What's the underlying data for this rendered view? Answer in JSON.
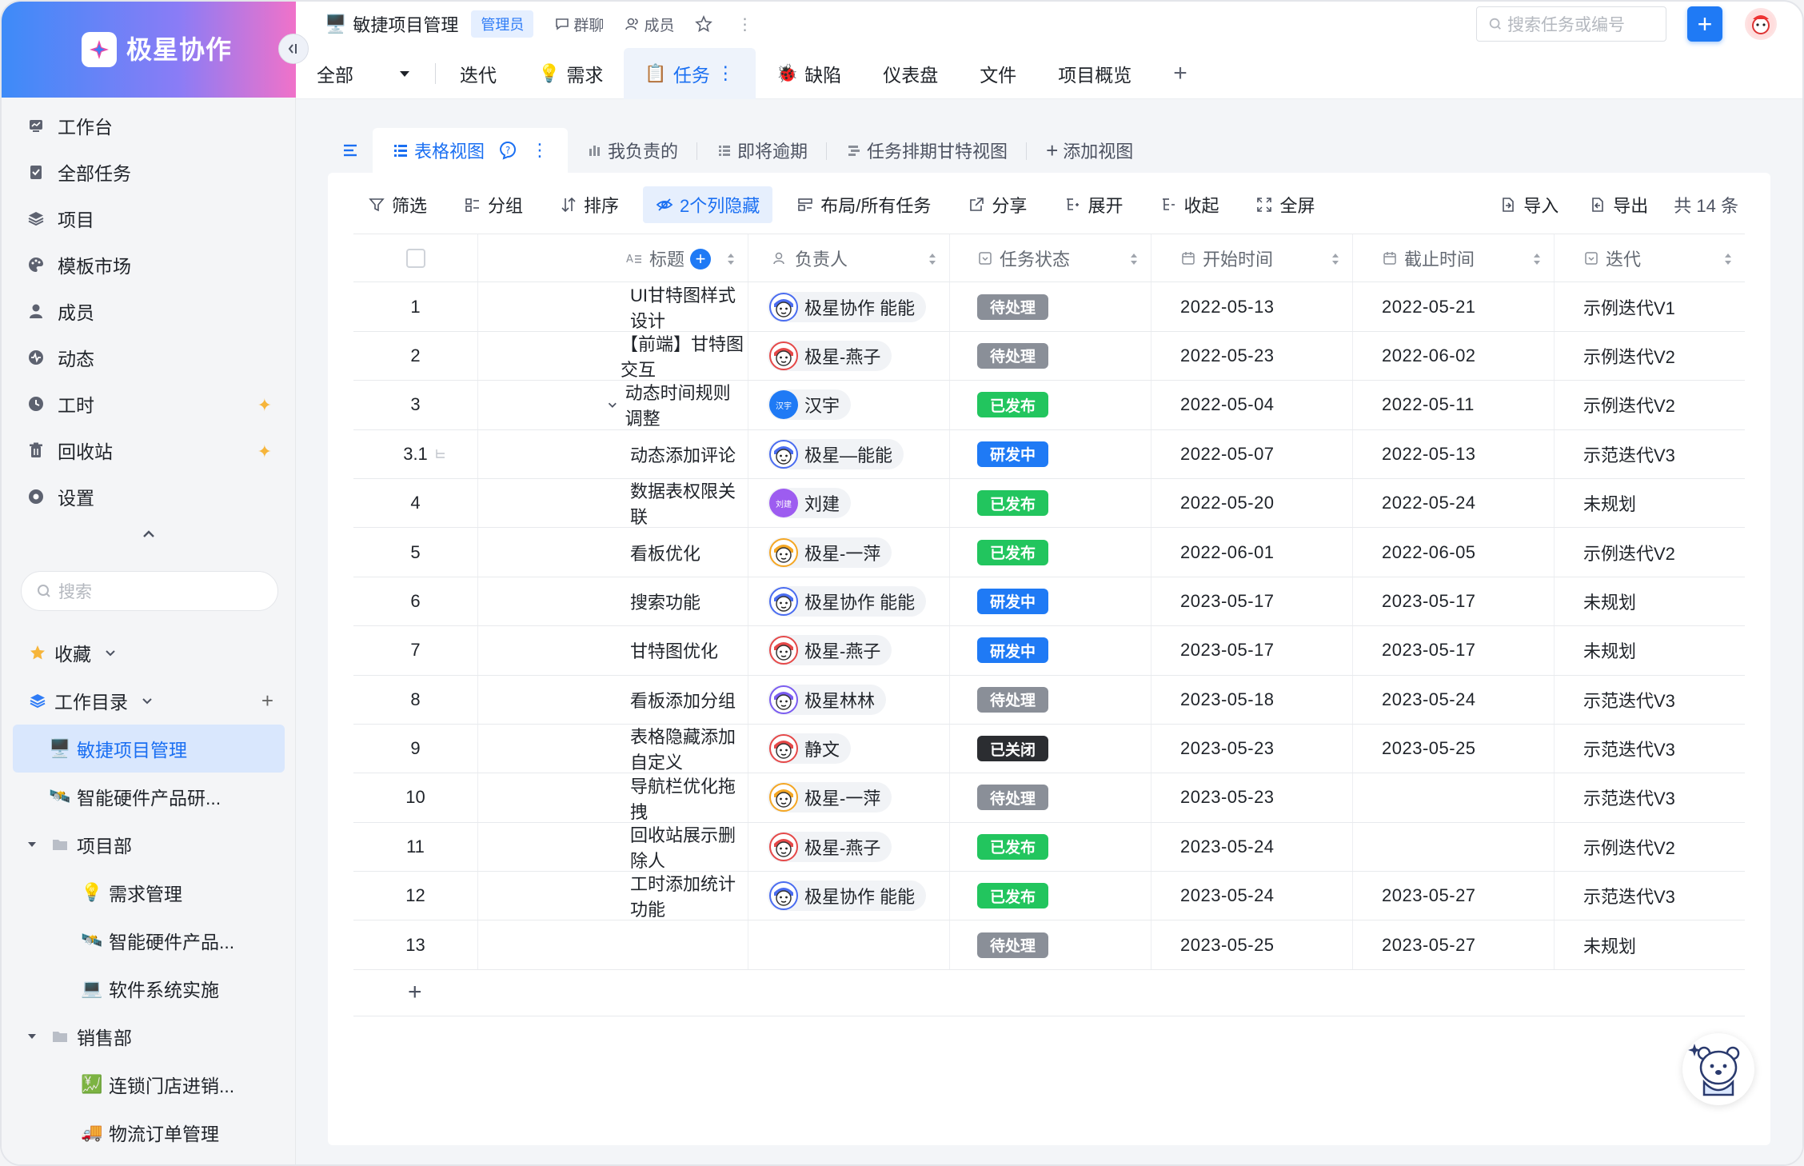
{
  "brand": {
    "name": "极星协作"
  },
  "sidebar": {
    "nav": [
      {
        "label": "工作台",
        "icon": "dashboard-icon",
        "star": false
      },
      {
        "label": "全部任务",
        "icon": "tasks-icon",
        "star": false
      },
      {
        "label": "项目",
        "icon": "layers-icon",
        "star": false
      },
      {
        "label": "模板市场",
        "icon": "palette-icon",
        "star": false
      },
      {
        "label": "成员",
        "icon": "user-icon",
        "star": false
      },
      {
        "label": "动态",
        "icon": "activity-icon",
        "star": false
      },
      {
        "label": "工时",
        "icon": "clock-icon",
        "star": true
      },
      {
        "label": "回收站",
        "icon": "trash-icon",
        "star": true
      },
      {
        "label": "设置",
        "icon": "settings-icon",
        "star": false
      }
    ],
    "search_placeholder": "搜索",
    "favorites_label": "收藏",
    "workdir_label": "工作目录",
    "tree": [
      {
        "label": "敏捷项目管理",
        "emoji": "🖥️",
        "indent": 1,
        "active": true
      },
      {
        "label": "智能硬件产品研...",
        "emoji": "🛰️",
        "indent": 1,
        "active": false
      },
      {
        "label": "项目部",
        "folder": true,
        "indent": 0
      },
      {
        "label": "需求管理",
        "emoji": "💡",
        "indent": 2
      },
      {
        "label": "智能硬件产品...",
        "emoji": "🛰️",
        "indent": 2
      },
      {
        "label": "软件系统实施",
        "emoji": "💻",
        "indent": 2
      },
      {
        "label": "销售部",
        "folder": true,
        "indent": 0
      },
      {
        "label": "连锁门店进销...",
        "emoji": "💹",
        "indent": 2
      },
      {
        "label": "物流订单管理",
        "emoji": "🚚",
        "indent": 2
      }
    ]
  },
  "header": {
    "project": "敏捷项目管理",
    "role": "管理员",
    "group_chat": "群聊",
    "members": "成员",
    "search_placeholder": "搜索任务或编号"
  },
  "module_tabs": {
    "all": "全部",
    "items": [
      {
        "label": "迭代",
        "emoji": ""
      },
      {
        "label": "需求",
        "emoji": "💡"
      },
      {
        "label": "任务",
        "emoji": "📋",
        "active": true
      },
      {
        "label": "缺陷",
        "emoji": "🐞"
      },
      {
        "label": "仪表盘",
        "emoji": ""
      },
      {
        "label": "文件",
        "emoji": ""
      },
      {
        "label": "项目概览",
        "emoji": ""
      }
    ]
  },
  "views": {
    "items": [
      "表格视图",
      "我负责的",
      "即将逾期",
      "任务排期甘特视图",
      "添加视图"
    ]
  },
  "toolbar": {
    "filter": "筛选",
    "group": "分组",
    "sort": "排序",
    "hidden": "2个列隐藏",
    "layout": "布局/所有任务",
    "share": "分享",
    "expand": "展开",
    "collapse": "收起",
    "fullscreen": "全屏",
    "import": "导入",
    "export": "导出",
    "count": "共 14 条"
  },
  "columns": [
    "标题",
    "负责人",
    "任务状态",
    "开始时间",
    "截止时间",
    "迭代"
  ],
  "status_colors": {
    "待处理": "#8a8f98",
    "已发布": "#22c55e",
    "研发中": "#1f7af5",
    "已关闭": "#2b2d31"
  },
  "rows": [
    {
      "no": "1",
      "title": "UI甘特图样式设计",
      "owner": "极星协作 能能",
      "avatar": "blue",
      "status": "待处理",
      "start": "2022-05-13",
      "end": "2022-05-21",
      "iter": "示例迭代V1"
    },
    {
      "no": "2",
      "title": "【前端】甘特图交互",
      "owner": "极星-燕子",
      "avatar": "red",
      "status": "待处理",
      "start": "2022-05-23",
      "end": "2022-06-02",
      "iter": "示例迭代V2"
    },
    {
      "no": "3",
      "title": "动态时间规则调整",
      "owner": "汉宇",
      "avatar": "bluetext",
      "avatar_text": "汉宇",
      "status": "已发布",
      "start": "2022-05-04",
      "end": "2022-05-11",
      "iter": "示例迭代V2",
      "expand": true
    },
    {
      "no": "3.1",
      "title": "动态添加评论",
      "owner": "极星—能能",
      "avatar": "blue",
      "status": "研发中",
      "start": "2022-05-07",
      "end": "2022-05-13",
      "iter": "示范迭代V3",
      "child": true
    },
    {
      "no": "4",
      "title": "数据表权限关联",
      "owner": "刘建",
      "avatar": "purpletext",
      "avatar_text": "刘建",
      "status": "已发布",
      "start": "2022-05-20",
      "end": "2022-05-24",
      "iter": "未规划"
    },
    {
      "no": "5",
      "title": "看板优化",
      "owner": "极星-一萍",
      "avatar": "yellow",
      "status": "已发布",
      "start": "2022-06-01",
      "end": "2022-06-05",
      "iter": "示例迭代V2"
    },
    {
      "no": "6",
      "title": "搜索功能",
      "owner": "极星协作 能能",
      "avatar": "blue",
      "status": "研发中",
      "start": "2023-05-17",
      "end": "2023-05-17",
      "iter": "未规划"
    },
    {
      "no": "7",
      "title": "甘特图优化",
      "owner": "极星-燕子",
      "avatar": "red",
      "status": "研发中",
      "start": "2023-05-17",
      "end": "2023-05-17",
      "iter": "未规划"
    },
    {
      "no": "8",
      "title": "看板添加分组",
      "owner": "极星林林",
      "avatar": "purple",
      "status": "待处理",
      "start": "2023-05-18",
      "end": "2023-05-24",
      "iter": "示范迭代V3"
    },
    {
      "no": "9",
      "title": "表格隐藏添加自定义",
      "owner": "静文",
      "avatar": "red",
      "status": "已关闭",
      "start": "2023-05-23",
      "end": "2023-05-25",
      "iter": "示范迭代V3"
    },
    {
      "no": "10",
      "title": "导航栏优化拖拽",
      "owner": "极星-一萍",
      "avatar": "yellow",
      "status": "待处理",
      "start": "2023-05-23",
      "end": "",
      "iter": "示范迭代V3"
    },
    {
      "no": "11",
      "title": "回收站展示删除人",
      "owner": "极星-燕子",
      "avatar": "red",
      "status": "已发布",
      "start": "2023-05-24",
      "end": "",
      "iter": "示例迭代V2"
    },
    {
      "no": "12",
      "title": "工时添加统计功能",
      "owner": "极星协作 能能",
      "avatar": "blue",
      "status": "已发布",
      "start": "2023-05-24",
      "end": "2023-05-27",
      "iter": "示范迭代V3"
    },
    {
      "no": "13",
      "title": "",
      "owner": "",
      "avatar": "",
      "status": "待处理",
      "start": "2023-05-25",
      "end": "2023-05-27",
      "iter": "未规划"
    }
  ],
  "add_row": "+"
}
